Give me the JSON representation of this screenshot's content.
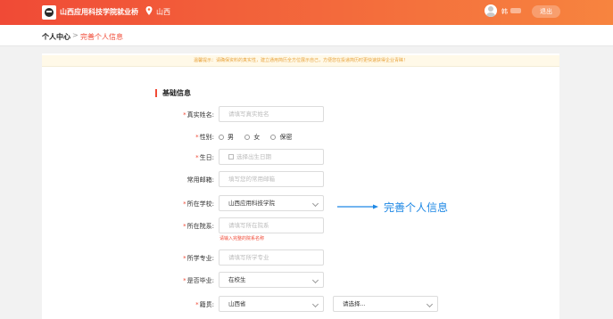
{
  "header": {
    "site_name": "山西应用科技学院就业桥",
    "location": "山西",
    "username": "韩",
    "logout_label": "退出"
  },
  "breadcrumb": {
    "root": "个人中心",
    "separator": ">",
    "current": "完善个人信息"
  },
  "notice": "温馨提示：请确保资料的真实性，建立通用简历全方位展示自己，方便您在投递简历时更快速获得企业青睐！",
  "section_title": "基础信息",
  "form": {
    "real_name": {
      "label": "真实姓名:",
      "required": "*",
      "placeholder": "请填写真实姓名"
    },
    "gender": {
      "label": "性别:",
      "required": "*",
      "options": [
        "男",
        "女",
        "保密"
      ]
    },
    "birthday": {
      "label": "生日:",
      "required": "*",
      "placeholder": "选择出生日期"
    },
    "email": {
      "label": "常用邮箱:",
      "placeholder": "填写您的常用邮箱"
    },
    "school": {
      "label": "所在学校:",
      "required": "*",
      "value": "山西应用科技学院"
    },
    "department": {
      "label": "所在院系:",
      "required": "*",
      "placeholder": "请填写所在院系",
      "hint": "请输入完整的院系名称"
    },
    "major": {
      "label": "所学专业:",
      "required": "*",
      "placeholder": "请填写所学专业"
    },
    "graduated": {
      "label": "是否毕业:",
      "required": "*",
      "value": "在校生"
    },
    "hometown": {
      "label": "籍贯:",
      "required": "*",
      "province": "山西省",
      "city_placeholder": "请选择..."
    }
  },
  "annotation": {
    "text": "完善个人信息",
    "color": "#1e88e5"
  },
  "colors": {
    "brand_start": "#f04a36",
    "brand_end": "#f7843f",
    "required": "#f04a36"
  }
}
